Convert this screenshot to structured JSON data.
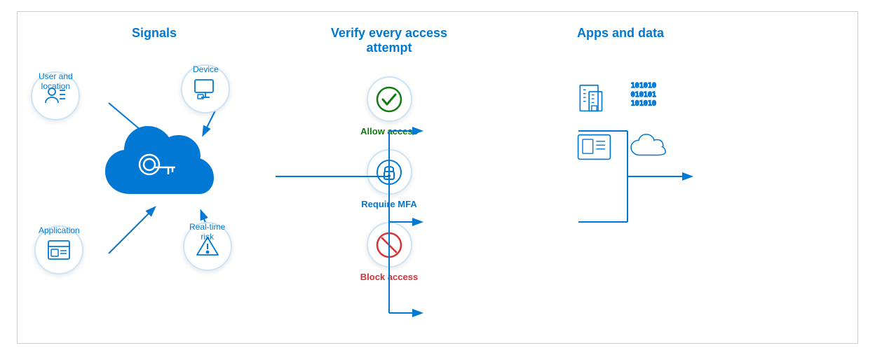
{
  "sections": {
    "signals": {
      "title": "Signals",
      "items": [
        {
          "label": "User and\nlocation",
          "icon": "user-list"
        },
        {
          "label": "Device",
          "icon": "monitor"
        },
        {
          "label": "Application",
          "icon": "app-window"
        },
        {
          "label": "Real-time\nrisk",
          "icon": "warning-triangle"
        }
      ]
    },
    "verify": {
      "title": "Verify every access\nattempt",
      "items": [
        {
          "label": "Allow access",
          "color": "green",
          "icon": "checkmark"
        },
        {
          "label": "Require MFA",
          "color": "blue",
          "icon": "lock"
        },
        {
          "label": "Block access",
          "color": "red",
          "icon": "no-circle"
        }
      ]
    },
    "apps": {
      "title": "Apps and data",
      "icons": [
        "building",
        "binary-data",
        "dashboard",
        "cloud"
      ]
    }
  },
  "colors": {
    "blue": "#0078d4",
    "green": "#107c10",
    "red": "#d13438",
    "circle_border": "#cce4f5"
  }
}
